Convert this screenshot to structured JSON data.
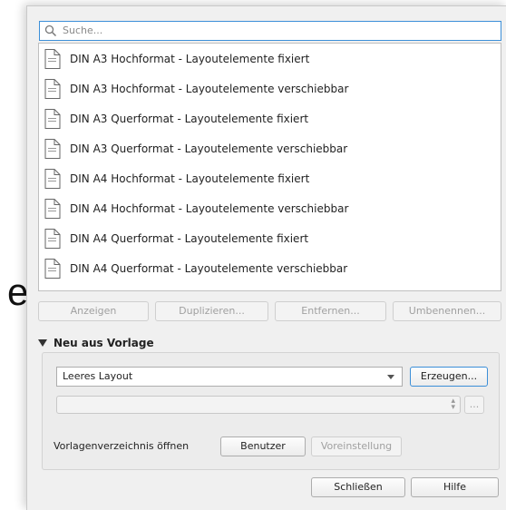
{
  "background_letter": "e",
  "search": {
    "placeholder": "Suche..."
  },
  "templates": [
    "DIN A3 Hochformat - Layoutelemente fixiert",
    "DIN A3 Hochformat - Layoutelemente verschiebbar",
    "DIN A3 Querformat - Layoutelemente fixiert",
    "DIN A3 Querformat - Layoutelemente verschiebbar",
    "DIN A4 Hochformat - Layoutelemente fixiert",
    "DIN A4 Hochformat - Layoutelemente verschiebbar",
    "DIN A4 Querformat - Layoutelemente fixiert",
    "DIN A4 Querformat - Layoutelemente verschiebbar"
  ],
  "actions": {
    "show": "Anzeigen",
    "duplicate": "Duplizieren...",
    "remove": "Entfernen...",
    "rename": "Umbenennen..."
  },
  "new_from_template": {
    "title": "Neu aus Vorlage",
    "selected": "Leeres Layout",
    "create": "Erzeugen...",
    "browse": "...",
    "path_value": "",
    "open_dir_label": "Vorlagenverzeichnis öffnen",
    "user": "Benutzer",
    "default": "Voreinstellung"
  },
  "footer": {
    "close": "Schließen",
    "help": "Hilfe"
  },
  "icons": {
    "search": "search-icon",
    "document": "document-icon",
    "collapse": "triangle-down-icon",
    "combo": "chevron-down-icon"
  }
}
